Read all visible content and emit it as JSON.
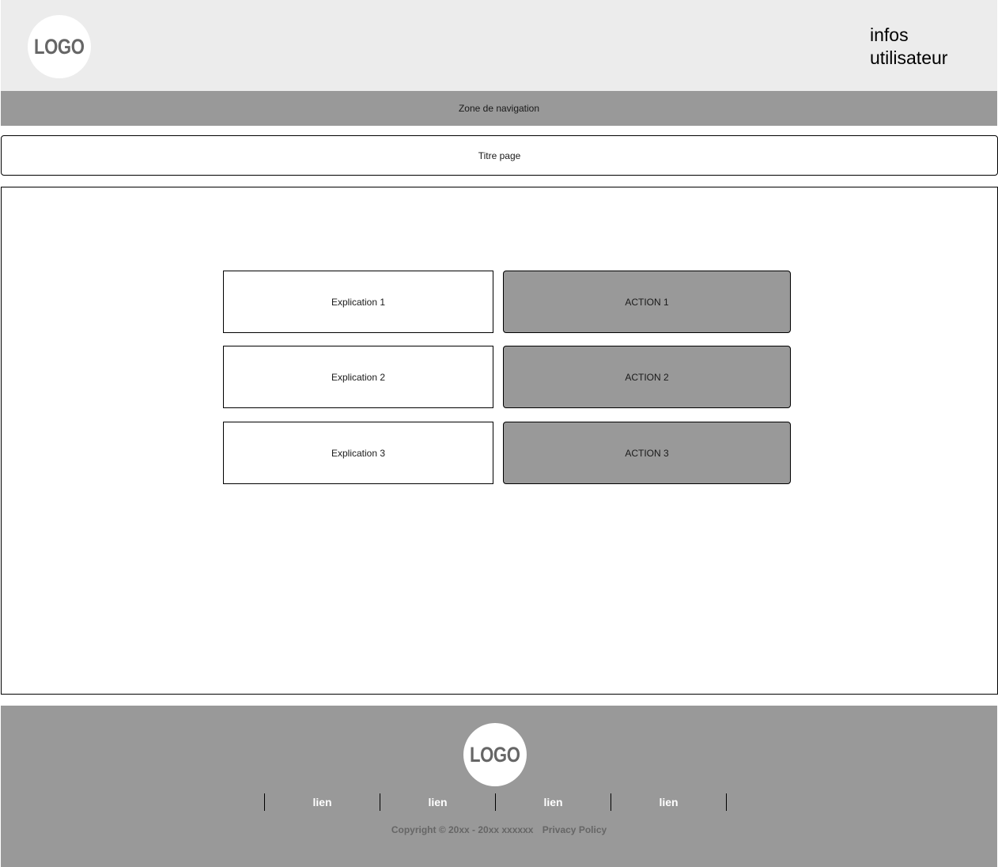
{
  "header": {
    "logo": "LOGO",
    "user_info": "infos\nutilisateur"
  },
  "nav": {
    "label": "Zone de navigation"
  },
  "page_title": "Titre page",
  "rows": [
    {
      "explanation": "Explication 1",
      "action": "ACTION 1"
    },
    {
      "explanation": "Explication 2",
      "action": "ACTION 2"
    },
    {
      "explanation": "Explication 3",
      "action": "ACTION 3"
    }
  ],
  "footer": {
    "logo": "LOGO",
    "links": [
      "lien",
      "lien",
      "lien",
      "lien"
    ],
    "copyright": "Copyright © 20xx - 20xx xxxxxx",
    "privacy": "Privacy Policy"
  },
  "colors": {
    "header_bg": "#ececec",
    "nav_bg": "#999999",
    "action_bg": "#999999",
    "footer_bg": "#999999",
    "logo_text": "#666666"
  }
}
